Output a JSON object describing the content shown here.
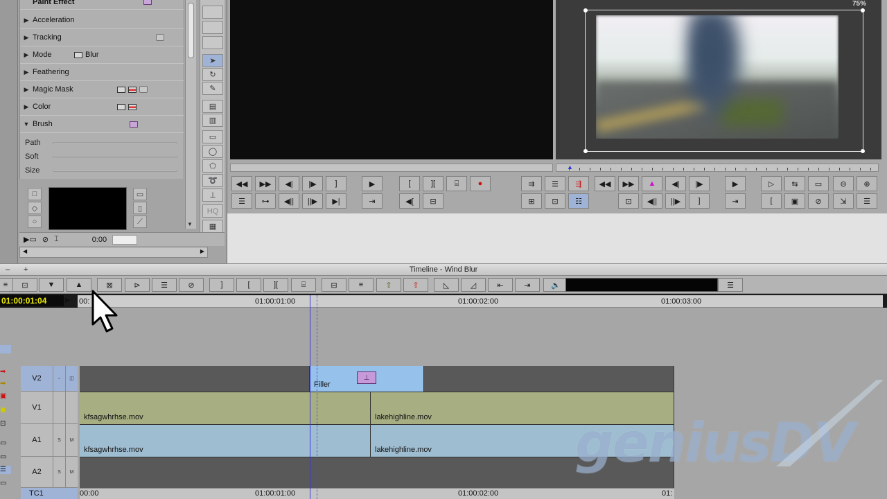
{
  "effect_editor": {
    "parameters": [
      {
        "label": "Paint Effect",
        "expanded": false
      },
      {
        "label": "Acceleration",
        "expanded": false
      },
      {
        "label": "Tracking",
        "expanded": false
      },
      {
        "label": "Mode",
        "expanded": false,
        "value": "Blur"
      },
      {
        "label": "Feathering",
        "expanded": false
      },
      {
        "label": "Magic Mask",
        "expanded": false
      },
      {
        "label": "Color",
        "expanded": false
      },
      {
        "label": "Brush",
        "expanded": true
      }
    ],
    "brush_sliders": [
      "Path",
      "Soft",
      "Size"
    ],
    "footer_time": "0:00"
  },
  "record_monitor": {
    "zoom": "75%"
  },
  "timeline": {
    "title": "Timeline - Wind Blur",
    "timecode": "01:00:01:04",
    "ruler_labels": [
      {
        "text": "00:",
        "pos": 0
      },
      {
        "text": "01:00:01:00",
        "pos": 1
      },
      {
        "text": "01:00:02:00",
        "pos": 2
      },
      {
        "text": "01:00:03:00",
        "pos": 3
      }
    ],
    "tc1_labels": [
      {
        "text": "00:00",
        "pos": 0
      },
      {
        "text": "01:00:01:00",
        "pos": 1
      },
      {
        "text": "01:00:02:00",
        "pos": 2
      },
      {
        "text": "01:",
        "pos": 3
      }
    ],
    "tracks": [
      {
        "name": "V2"
      },
      {
        "name": "V1"
      },
      {
        "name": "A1"
      },
      {
        "name": "A2"
      },
      {
        "name": "TC1"
      }
    ],
    "clips": {
      "filler": "Filler",
      "v1_a": "kfsagwhrhse.mov",
      "v1_b": "lakehighline.mov",
      "a1_a": "kfsagwhrhse.mov",
      "a1_b": "lakehighline.mov"
    }
  },
  "watermark": "geniusDV",
  "colors": {
    "filler_clip": "#96c1ea",
    "video_clip": "#a6ae82",
    "audio_clip": "#9fbdd0",
    "selection": "#9fb3d6",
    "timecode_text": "#e8e800",
    "playhead": "#3a3ae0"
  }
}
